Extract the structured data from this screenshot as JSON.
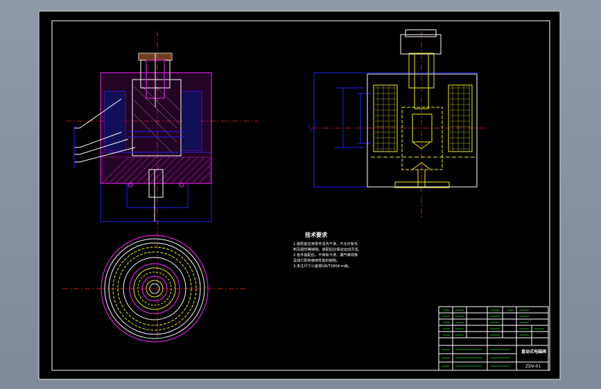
{
  "drawing": {
    "tech_title": "技术要求",
    "tech_notes": [
      "1.装配前应将零件清洗干净，不允许有毛",
      "  刺及碰伤等缺陷。装配后应保证运动灵活。",
      "2.各件装配后，不得有卡滞、漏气等现象",
      "  及其它影响使用性能的缺陷。",
      "3.未注尺寸公差按GB/T1804-m级。"
    ],
    "title_block": {
      "name": "直动式电磁阀",
      "code": "ZDV-01"
    }
  },
  "colors": {
    "magenta": "#e020e0",
    "yellow": "#f0f020",
    "blue": "#2020ff",
    "red": "#ff2020",
    "green": "#20e020",
    "white": "#ffffff"
  }
}
